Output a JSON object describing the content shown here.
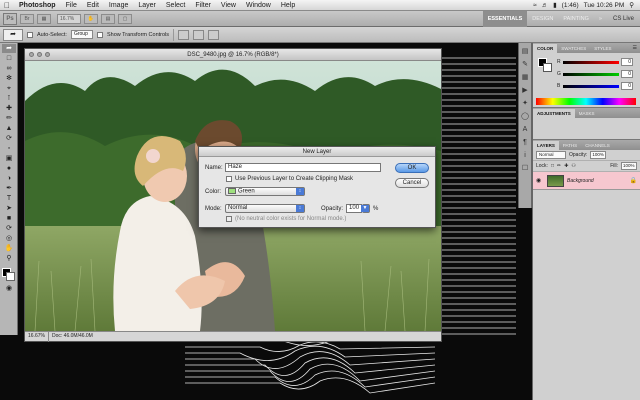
{
  "menubar": {
    "app": "Photoshop",
    "items": [
      "File",
      "Edit",
      "Image",
      "Layer",
      "Select",
      "Filter",
      "View",
      "Window",
      "Help"
    ],
    "battery": "(1:46)",
    "clock": "Tue 10:26 PM"
  },
  "appbar": {
    "logo": "Ps",
    "zoom_value": "16.7%",
    "workspaces": [
      "ESSENTIALS",
      "DESIGN",
      "PAINTING"
    ],
    "cs_live": "CS Live"
  },
  "options": {
    "auto_select": "Auto-Select:",
    "group_value": "Group",
    "show_transform": "Show Transform Controls"
  },
  "document": {
    "title": "DSC_9480.jpg @ 16.7% (RGB/8*)",
    "zoom": "16.67%",
    "doc_info": "Doc: 46.0M/46.0M"
  },
  "panels": {
    "color_tabs": [
      "COLOR",
      "SWATCHES",
      "STYLES"
    ],
    "channels": [
      {
        "ch": "R",
        "value": "0"
      },
      {
        "ch": "G",
        "value": "0"
      },
      {
        "ch": "B",
        "value": "0"
      }
    ],
    "adj_tabs": [
      "ADJUSTMENTS",
      "MASKS"
    ],
    "layer_tabs": [
      "LAYERS",
      "PATHS",
      "CHANNELS"
    ],
    "blend_mode": "Normal",
    "opacity_label": "Opacity:",
    "opacity_value": "100%",
    "lock_label": "Lock:",
    "fill_label": "Fill:",
    "fill_value": "100%",
    "layer_name": "Background"
  },
  "dialog": {
    "title": "New Layer",
    "name_label": "Name:",
    "name_value": "Haze",
    "clipping_label": "Use Previous Layer to Create Clipping Mask",
    "color_label": "Color:",
    "color_value": "Green",
    "mode_label": "Mode:",
    "mode_value": "Normal",
    "opacity_label": "Opacity:",
    "opacity_value": "100",
    "percent": "%",
    "neutral_label": "(No neutral color exists for Normal mode.)",
    "ok": "OK",
    "cancel": "Cancel"
  },
  "colors": {
    "layer_highlight": "#f6c7cf",
    "ok_button": "#5a99e6",
    "green_swatch": "#9ee07e"
  }
}
